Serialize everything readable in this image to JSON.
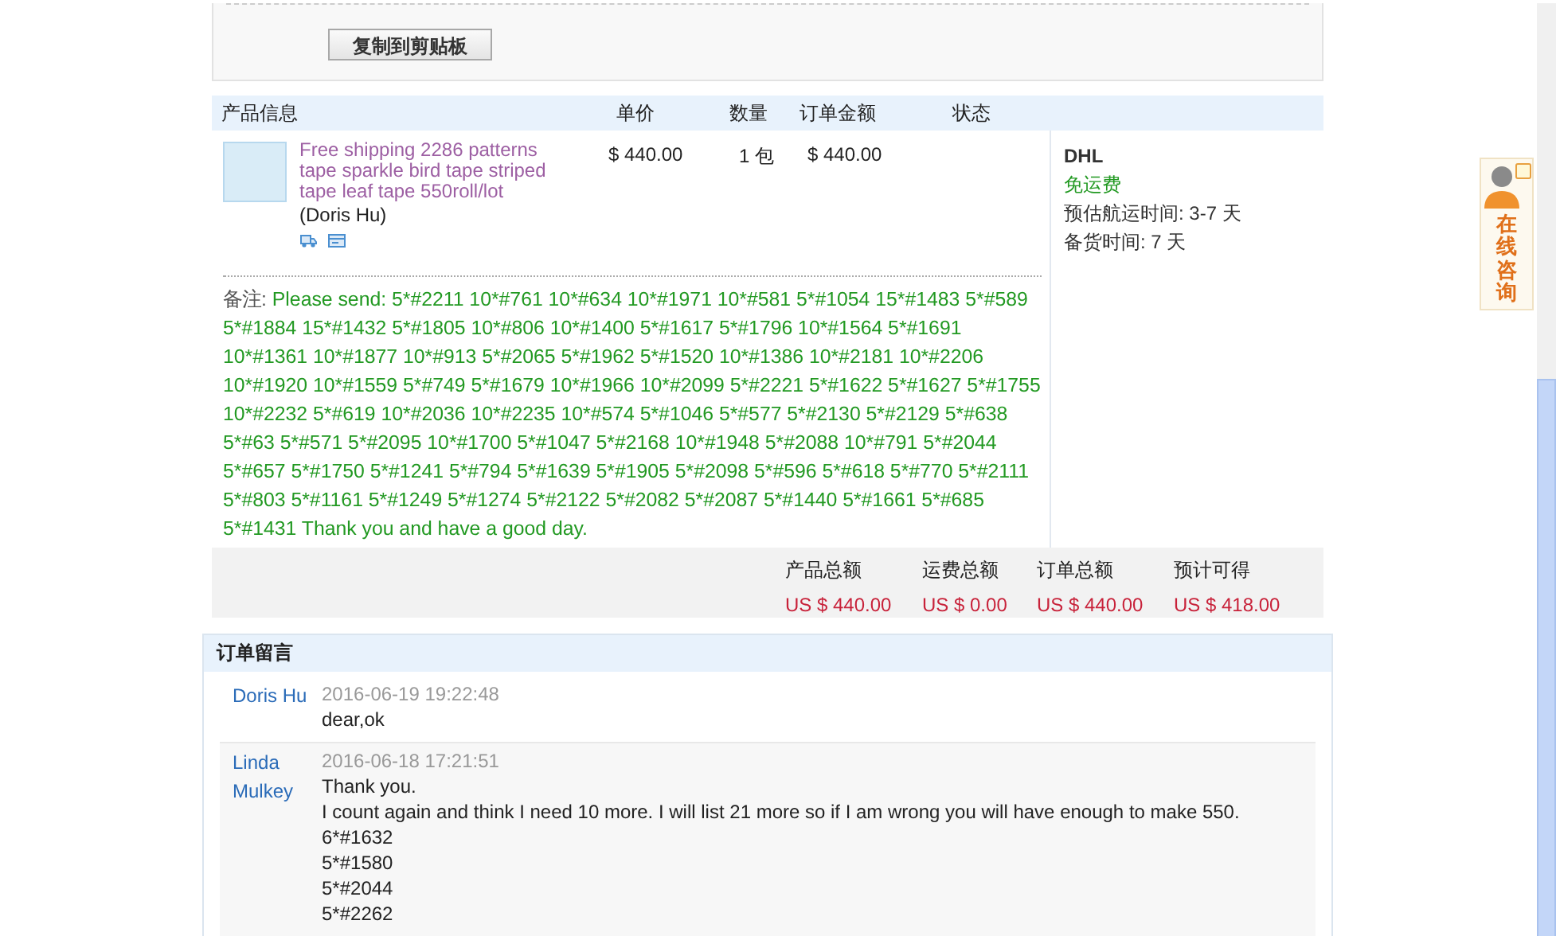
{
  "copy_button": {
    "label": "复制到剪贴板"
  },
  "order_table": {
    "columns": [
      "产品信息",
      "单价",
      "数量",
      "订单金额",
      "状态"
    ],
    "product": {
      "title": "Free shipping 2286 patterns tape sparkle bird tape striped tape leaf tape 550roll/lot",
      "seller": "(Doris Hu)",
      "unit_price": "$ 440.00",
      "quantity": "1 包",
      "amount": "$ 440.00",
      "note_label": "备注:",
      "note": "Please send: 5*#2211 10*#761 10*#634 10*#1971 10*#581 5*#1054 15*#1483 5*#589 5*#1884 15*#1432 5*#1805 10*#806 10*#1400 5*#1617 5*#1796 10*#1564 5*#1691 10*#1361 10*#1877 10*#913 5*#2065 5*#1962 5*#1520 10*#1386 10*#2181 10*#2206 10*#1920 10*#1559 5*#749 5*#1679 10*#1966 10*#2099 5*#2221 5*#1622 5*#1627 5*#1755 10*#2232 5*#619 10*#2036 10*#2235 10*#574 5*#1046 5*#577 5*#2130 5*#2129 5*#638 5*#63 5*#571 5*#2095 10*#1700 5*#1047 5*#2168 10*#1948 5*#2088 10*#791 5*#2044 5*#657 5*#1750 5*#1241 5*#794 5*#1639 5*#1905 5*#2098 5*#596 5*#618 5*#770 5*#2111 5*#803 5*#1161 5*#1249 5*#1274 5*#2122 5*#2082 5*#2087 5*#1440 5*#1661 5*#685 5*#1431 Thank you and have a good day."
    },
    "shipping": {
      "carrier": "DHL",
      "fee": "免运费",
      "lines": [
        "预估航运时间: 3-7 天",
        "备货时间: 7 天"
      ]
    },
    "totals": [
      {
        "label": "产品总额",
        "value": "US $ 440.00"
      },
      {
        "label": "运费总额",
        "value": "US $ 0.00"
      },
      {
        "label": "订单总额",
        "value": "US $ 440.00"
      },
      {
        "label": "预计可得",
        "value": "US $ 418.00"
      }
    ]
  },
  "messages": {
    "title": "订单留言",
    "items": [
      {
        "author": "Doris Hu",
        "time": "2016-06-19 19:22:48",
        "lines": [
          "dear,ok"
        ]
      },
      {
        "author": "Linda Mulkey",
        "time": "2016-06-18 17:21:51",
        "lines": [
          "Thank you.",
          "I count again and think I need 10 more. I will list 21 more so if I am wrong you will have enough to make 550.",
          "6*#1632",
          "5*#1580",
          "5*#2044",
          "5*#2262"
        ]
      }
    ]
  },
  "side_widget": {
    "label": "在线咨询"
  }
}
